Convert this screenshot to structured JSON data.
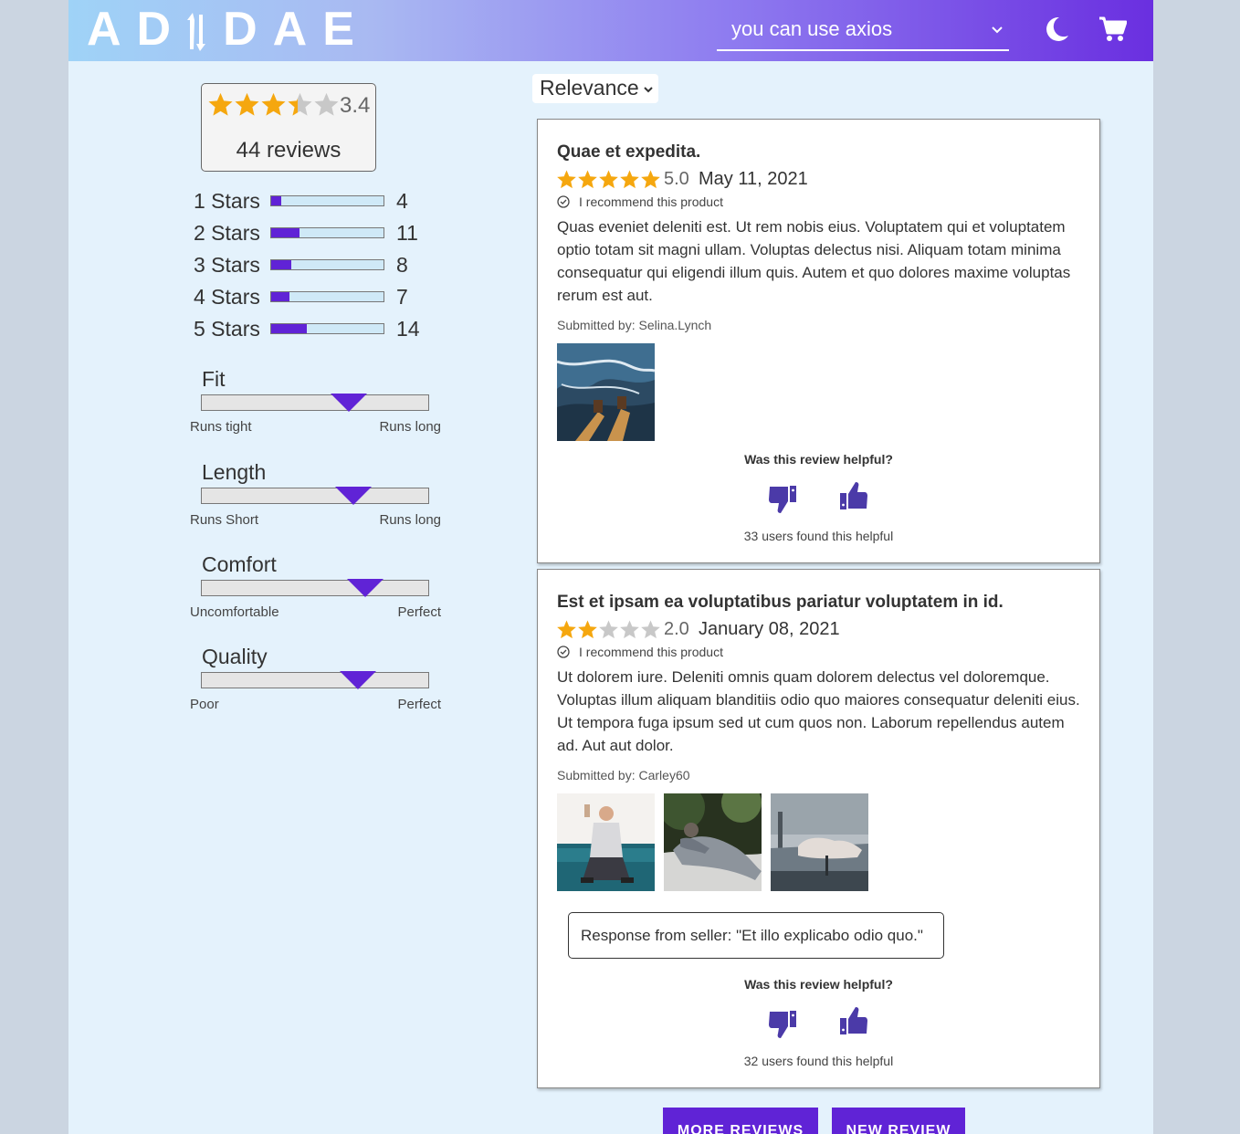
{
  "header": {
    "logo_text": "ADIDAE",
    "search": {
      "value": "you can use axios",
      "placeholder": ""
    },
    "icons": [
      "moon-icon",
      "cart-icon",
      "chevron-down-icon"
    ],
    "gradient": [
      "#9fd3f7",
      "#8f7df0",
      "#6a2fe0"
    ]
  },
  "summary": {
    "rating": "3.4",
    "rating_value": 3.4,
    "reviews_label": "44 reviews"
  },
  "breakdown": [
    {
      "label": "1 Stars",
      "count": "4",
      "fraction": 0.09
    },
    {
      "label": "2 Stars",
      "count": "11",
      "fraction": 0.25
    },
    {
      "label": "3 Stars",
      "count": "8",
      "fraction": 0.18
    },
    {
      "label": "4 Stars",
      "count": "7",
      "fraction": 0.16
    },
    {
      "label": "5 Stars",
      "count": "14",
      "fraction": 0.32
    }
  ],
  "characteristics": [
    {
      "name": "Fit",
      "low": "Runs tight",
      "high": "Runs long",
      "position": 0.65
    },
    {
      "name": "Length",
      "low": "Runs Short",
      "high": "Runs long",
      "position": 0.67
    },
    {
      "name": "Comfort",
      "low": "Uncomfortable",
      "high": "Perfect",
      "position": 0.72
    },
    {
      "name": "Quality",
      "low": "Poor",
      "high": "Perfect",
      "position": 0.69
    }
  ],
  "sort": {
    "selected": "Relevance"
  },
  "reviews": [
    {
      "title": "Quae et expedita.",
      "rating": "5.0",
      "stars": 5,
      "date": "May 11, 2021",
      "recommend": "I recommend this product",
      "body": "Quas eveniet deleniti est. Ut rem nobis eius. Voluptatem qui et voluptatem optio totam sit magni ullam. Voluptas delectus nisi. Aliquam totam minima consequatur qui eligendi illum quis. Autem et quo dolores maxime voluptas rerum est aut.",
      "author": "Submitted by: Selina.Lynch",
      "photos": [
        "review photo"
      ],
      "helpful_question": "Was this review helpful?",
      "helpful_count": "33 users found this helpful"
    },
    {
      "title": "Est et ipsam ea voluptatibus pariatur voluptatem in id.",
      "rating": "2.0",
      "stars": 2,
      "date": "January 08, 2021",
      "recommend": "I recommend this product",
      "body": "Ut dolorem iure. Deleniti omnis quam dolorem delectus vel doloremque. Voluptas illum aliquam blanditiis odio quo maiores consequatur deleniti eius. Ut tempora fuga ipsum sed ut cum quos non. Laborum repellendus autem ad. Aut aut dolor.",
      "author": "Submitted by: Carley60",
      "photos": [
        "review photo",
        "review photo",
        "review photo"
      ],
      "response": "Response from seller: \"Et illo explicabo odio quo.\"",
      "helpful_question": "Was this review helpful?",
      "helpful_count": "32 users found this helpful"
    }
  ],
  "buttons": {
    "more": "MORE REVIEWS",
    "add": "NEW REVIEW"
  },
  "colors": {
    "accent": "#6023d6",
    "star": "#f5a70f",
    "star_empty": "#c8c8c8",
    "page_bg": "#e4f2fc"
  }
}
